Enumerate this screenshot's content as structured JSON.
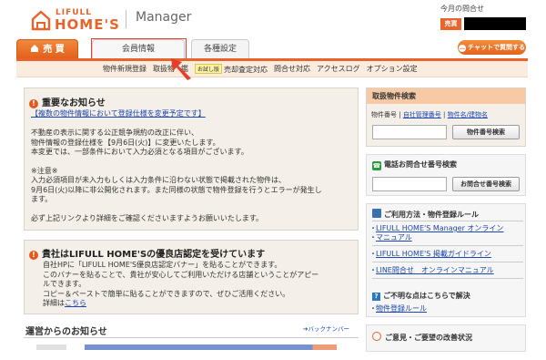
{
  "header": {
    "logo_small": "LIFULL",
    "logo_big": "HOME'S",
    "app_name": "Manager",
    "inquiry_title": "今月の問合せ",
    "inquiry_badge": "売買",
    "chat_button": "チャットで質問する"
  },
  "tabs": {
    "sell": "売 買",
    "member": "会員情報",
    "settings": "各種設定"
  },
  "subnav": {
    "items": [
      "物件新規登録",
      "取扱物",
      "鑑",
      "売却査定対応",
      "問合せ対応",
      "アクセスログ",
      "オプション設定"
    ],
    "trial_badge": "お試し版"
  },
  "notice": {
    "title": "重要なお知らせ",
    "link": "【複数の物件情報において登録仕様を変更予定です】",
    "lines": [
      "不動産の表示に関する公正競争規約の改正に伴い、",
      "物件情報の登録仕様を【9月6日(火)】に変更いたします。",
      "本変更では、一部条件において入力必須となる項目がございます。",
      "",
      "※注意※",
      "入力必須項目が未入力もしくは入力条件に沿わない状態で掲載された物件は、",
      "9月6日(火)以降に非公開化されます。また同様の状態で物件登録を行うとエラーが発生し",
      "ます。",
      "",
      "必ず上記リンクより詳細をご確認くださいますようお願いいたします。"
    ]
  },
  "shop": {
    "title": "貴社はLIFULL HOME'Sの優良店認定を受けています",
    "lines": [
      "自社HPに「LIFULL HOME'S優良店認定バナー」を貼ることができます。",
      "このバナーを貼ることで、貴社が安心してご利用いただける店舗ということがアピー",
      "ルできます。",
      "コピー＆ペーストで簡単に貼ることができますので、ぜひご活用ください。"
    ],
    "detail_prefix": "詳細は",
    "detail_link": "こちら"
  },
  "operations": {
    "title": "運営からのお知らせ",
    "back_number": "バックナンバー"
  },
  "property_search": {
    "title": "取扱物件検索",
    "type_selected": "物件番号",
    "type_mgmt": "自社管理番号",
    "type_name": "物件名/建物名",
    "button": "物件番号検索"
  },
  "phone_search": {
    "title": "電話お問合せ番号検索",
    "button": "お問合せ番号検索"
  },
  "help": {
    "title": "ご利用方法・物件登録ルール",
    "links": [
      "LIFULL HOME'S Manager オンライン",
      "マニュアル",
      "LIFULL HOME'S 掲載ガイドライン",
      "LINE問合せ　オンラインマニュアル"
    ],
    "question_title": "ご不明な点はこちらで解決",
    "question_link": "物件登録ルール"
  },
  "improve": {
    "title": "ご意見・ご要望の改善状況"
  },
  "colors": {
    "brand_orange": "#e9642b",
    "link_blue": "#1b47b0",
    "highlight_red": "#e53e2e"
  }
}
